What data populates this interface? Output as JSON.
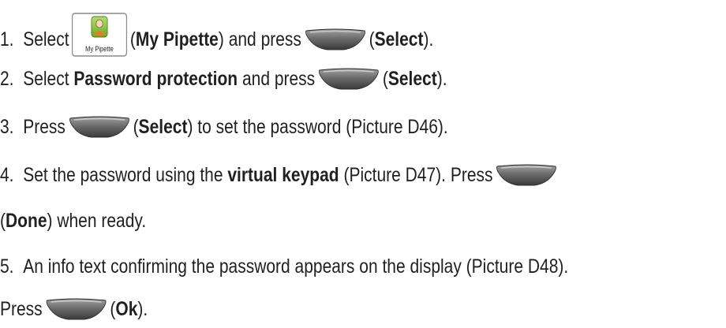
{
  "steps": [
    {
      "num": "1.",
      "parts": [
        "Select",
        "(",
        "My Pipette",
        ") and press",
        "(",
        "Select",
        ")."
      ],
      "icon_label": "My Pipette"
    },
    {
      "num": "2.",
      "parts": [
        "Select",
        "Password protection",
        "and press",
        "(",
        "Select",
        ")."
      ]
    },
    {
      "num": "3.",
      "parts": [
        "Press",
        "(",
        "Select",
        ") to set the password (Picture D46)."
      ]
    },
    {
      "num": "4.",
      "parts": [
        "Set the password using the",
        "virtual keypad",
        "(Picture D47). Press"
      ],
      "cont": [
        "(",
        "Done",
        ") when ready."
      ]
    },
    {
      "num": "5.",
      "parts": [
        "An info text confirming the password appears on the display (Picture D48)."
      ],
      "cont": [
        "Press",
        "(",
        "Ok",
        ")."
      ]
    }
  ],
  "icons": {
    "app": "my-pipette-app-icon",
    "softkey": "softkey-button-icon"
  },
  "colors": {
    "text": "#231f20",
    "softkey_top": "#9a9a9a",
    "softkey_bottom": "#3e3e3e",
    "app_icon_green": "#8cc63f"
  }
}
